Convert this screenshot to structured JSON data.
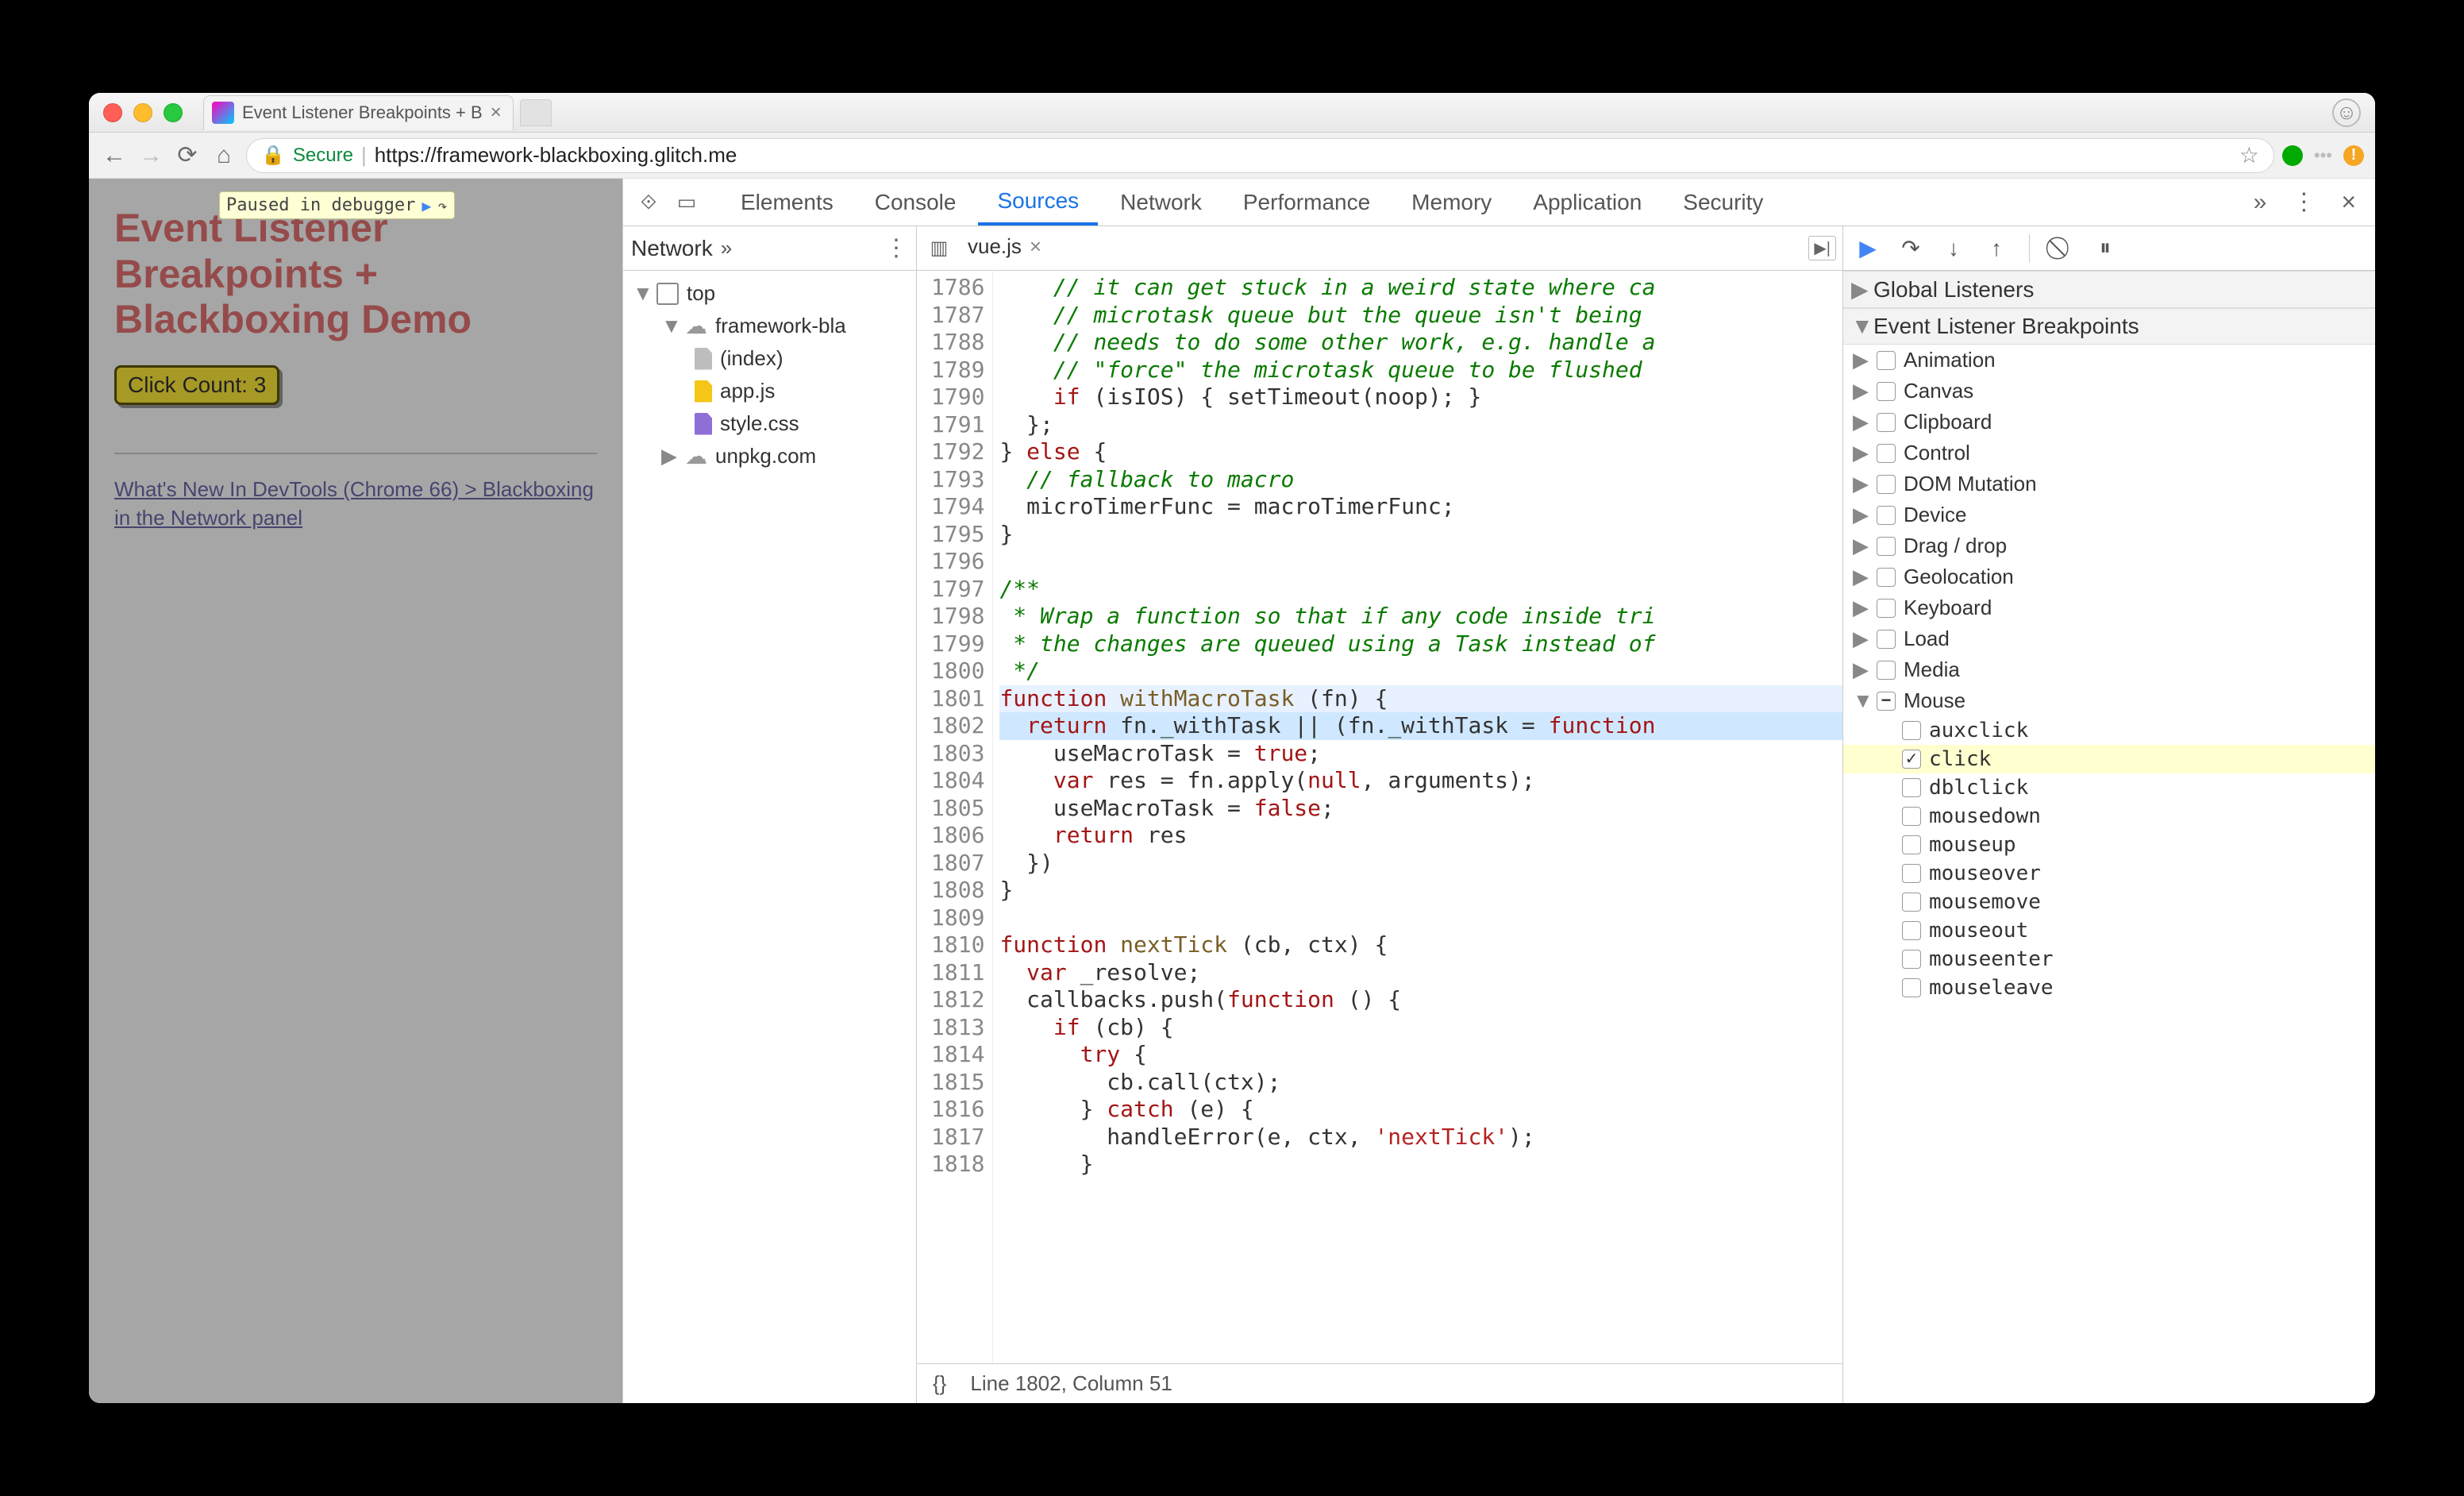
{
  "window": {
    "tab_title": "Event Listener Breakpoints + B",
    "secure_label": "Secure",
    "url_host": "https://framework-blackboxing.glitch.me",
    "url_path": ""
  },
  "page": {
    "heading": "Event Listener Breakpoints + Blackboxing Demo",
    "click_count_label": "Click Count: 3",
    "link_text": "What's New In DevTools (Chrome 66) > Blackboxing in the Network panel",
    "paused_text": "Paused in debugger"
  },
  "devtools": {
    "tabs": [
      "Elements",
      "Console",
      "Sources",
      "Network",
      "Performance",
      "Memory",
      "Application",
      "Security"
    ],
    "active_tab": "Sources",
    "nav_tab": "Network",
    "tree": {
      "top": "top",
      "domain1": "framework-bla",
      "files": [
        "(index)",
        "app.js",
        "style.css"
      ],
      "domain2": "unpkg.com"
    },
    "open_file": "vue.js",
    "status": "Line 1802, Column 51",
    "code_lines": [
      {
        "n": 1786,
        "html": "    <span class='cmnt'>// it can get stuck in a weird state where ca</span>"
      },
      {
        "n": 1787,
        "html": "    <span class='cmnt'>// microtask queue but the queue isn't being</span>"
      },
      {
        "n": 1788,
        "html": "    <span class='cmnt'>// needs to do some other work, e.g. handle a</span>"
      },
      {
        "n": 1789,
        "html": "    <span class='cmnt'>// \"force\" the microtask queue to be flushed</span>"
      },
      {
        "n": 1790,
        "html": "    <span class='kw'>if</span> (isIOS) { setTimeout(noop); }"
      },
      {
        "n": 1791,
        "html": "  };"
      },
      {
        "n": 1792,
        "html": "} <span class='kw'>else</span> {"
      },
      {
        "n": 1793,
        "html": "  <span class='cmnt'>// fallback to macro</span>"
      },
      {
        "n": 1794,
        "html": "  microTimerFunc = macroTimerFunc;"
      },
      {
        "n": 1795,
        "html": "}"
      },
      {
        "n": 1796,
        "html": ""
      },
      {
        "n": 1797,
        "html": "<span class='cmnt'>/**</span>"
      },
      {
        "n": 1798,
        "html": "<span class='cmnt'> * Wrap a function so that if any code inside tri</span>"
      },
      {
        "n": 1799,
        "html": "<span class='cmnt'> * the changes are queued using a Task instead of</span>"
      },
      {
        "n": 1800,
        "html": "<span class='cmnt'> */</span>"
      },
      {
        "n": 1801,
        "html": "<span class='kw'>function</span> <span class='fn'>withMacroTask</span> (fn) {",
        "cls": "hlrow-soft"
      },
      {
        "n": 1802,
        "html": "  <span class='kw'>return</span> fn._withTask || (fn._withTask = <span class='kw'>function</span>",
        "cls": "hlrow"
      },
      {
        "n": 1803,
        "html": "    useMacroTask = <span class='kw'>true</span>;"
      },
      {
        "n": 1804,
        "html": "    <span class='kw'>var</span> res = fn.apply(<span class='kw'>null</span>, arguments);"
      },
      {
        "n": 1805,
        "html": "    useMacroTask = <span class='kw'>false</span>;"
      },
      {
        "n": 1806,
        "html": "    <span class='kw'>return</span> res"
      },
      {
        "n": 1807,
        "html": "  })"
      },
      {
        "n": 1808,
        "html": "}"
      },
      {
        "n": 1809,
        "html": ""
      },
      {
        "n": 1810,
        "html": "<span class='kw'>function</span> <span class='fn'>nextTick</span> (cb, ctx) {"
      },
      {
        "n": 1811,
        "html": "  <span class='kw'>var</span> _resolve;"
      },
      {
        "n": 1812,
        "html": "  callbacks.push(<span class='kw'>function</span> () {"
      },
      {
        "n": 1813,
        "html": "    <span class='kw'>if</span> (cb) {"
      },
      {
        "n": 1814,
        "html": "      <span class='kw'>try</span> {"
      },
      {
        "n": 1815,
        "html": "        cb.call(ctx);"
      },
      {
        "n": 1816,
        "html": "      } <span class='kw'>catch</span> (e) {"
      },
      {
        "n": 1817,
        "html": "        handleError(e, ctx, <span class='str'>'nextTick'</span>);"
      },
      {
        "n": 1818,
        "html": "      }"
      }
    ],
    "right": {
      "global": "Global Listeners",
      "evbp": "Event Listener Breakpoints",
      "cats": [
        "Animation",
        "Canvas",
        "Clipboard",
        "Control",
        "DOM Mutation",
        "Device",
        "Drag / drop",
        "Geolocation",
        "Keyboard",
        "Load",
        "Media"
      ],
      "mouse": "Mouse",
      "mouse_events": [
        "auxclick",
        "click",
        "dblclick",
        "mousedown",
        "mouseup",
        "mouseover",
        "mousemove",
        "mouseout",
        "mouseenter",
        "mouseleave"
      ],
      "mouse_checked": "click"
    }
  }
}
